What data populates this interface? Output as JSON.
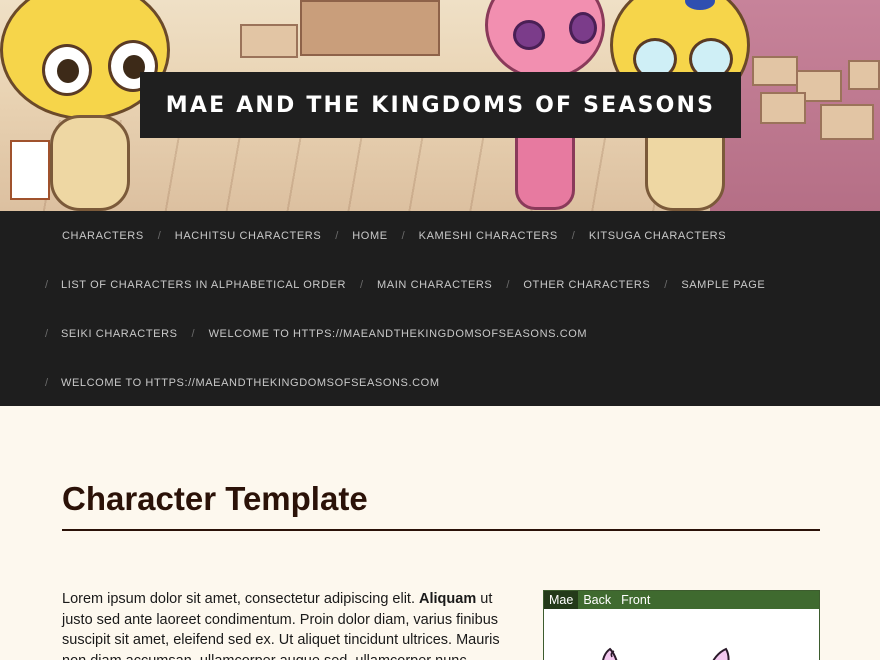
{
  "site": {
    "title": "MAE AND THE KINGDOMS OF SEASONS"
  },
  "nav": {
    "rows": [
      [
        "CHARACTERS",
        "HACHITSU CHARACTERS",
        "HOME",
        "KAMESHI CHARACTERS",
        "KITSUGA CHARACTERS"
      ],
      [
        "LIST OF CHARACTERS IN ALPHABETICAL ORDER",
        "MAIN CHARACTERS",
        "OTHER CHARACTERS",
        "SAMPLE PAGE"
      ],
      [
        "SEIKI CHARACTERS",
        "WELCOME TO HTTPS://MAEANDTHEKINGDOMSOFSEASONS.COM"
      ],
      [
        "WELCOME TO HTTPS://MAEANDTHEKINGDOMSOFSEASONS.COM"
      ]
    ],
    "separator": "/"
  },
  "page": {
    "title": "Character Template",
    "body_start": "Lorem ipsum dolor sit amet, consectetur adipiscing elit. ",
    "body_bold": "Aliquam",
    "body_rest": " ut justo sed ante laoreet condimentum. Proin dolor diam, varius finibus suscipit sit amet, eleifend sed ex. Ut aliquet tincidunt ultrices. Mauris non diam accumsan, ullamcorper augue sed, ullamcorper nunc."
  },
  "tabber": {
    "tabs": [
      "Mae",
      "Back",
      "Front"
    ],
    "active_tab": "Mae"
  },
  "colors": {
    "nav_bg": "#1e1e1e",
    "page_bg": "#fdf8ee",
    "title_color": "#2b1208",
    "tab_bar": "#3f6a2f"
  }
}
